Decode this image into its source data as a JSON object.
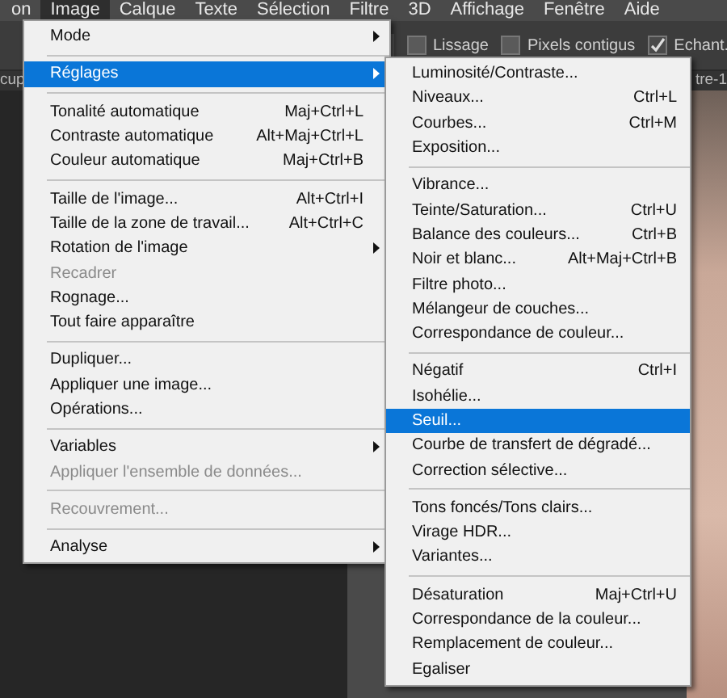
{
  "menubar": [
    {
      "label": "on",
      "selected": false
    },
    {
      "label": "Image",
      "selected": true
    },
    {
      "label": "Calque",
      "selected": false
    },
    {
      "label": "Texte",
      "selected": false
    },
    {
      "label": "Sélection",
      "selected": false
    },
    {
      "label": "Filtre",
      "selected": false
    },
    {
      "label": "3D",
      "selected": false
    },
    {
      "label": "Affichage",
      "selected": false
    },
    {
      "label": "Fenêtre",
      "selected": false
    },
    {
      "label": "Aide",
      "selected": false
    }
  ],
  "options_bar": {
    "checkboxes": [
      {
        "label": "Lissage",
        "checked": false
      },
      {
        "label": "Pixels contigus",
        "checked": false
      },
      {
        "label": "Echant.",
        "checked": true
      }
    ]
  },
  "document_tabs": [
    {
      "label": "cup"
    },
    {
      "label": "tre-1"
    }
  ],
  "image_menu": {
    "groups": [
      [
        {
          "label": "Mode",
          "has_submenu": true,
          "disabled": false,
          "selected": false
        }
      ],
      [
        {
          "label": "Réglages",
          "has_submenu": true,
          "disabled": false,
          "selected": true
        }
      ],
      [
        {
          "label": "Tonalité automatique",
          "shortcut": "Maj+Ctrl+L",
          "has_submenu": false,
          "disabled": false,
          "selected": false
        },
        {
          "label": "Contraste automatique",
          "shortcut": "Alt+Maj+Ctrl+L",
          "has_submenu": false,
          "disabled": false,
          "selected": false
        },
        {
          "label": "Couleur automatique",
          "shortcut": "Maj+Ctrl+B",
          "has_submenu": false,
          "disabled": false,
          "selected": false
        }
      ],
      [
        {
          "label": "Taille de l'image...",
          "shortcut": "Alt+Ctrl+I",
          "has_submenu": false,
          "disabled": false,
          "selected": false
        },
        {
          "label": "Taille de la zone de travail...",
          "shortcut": "Alt+Ctrl+C",
          "has_submenu": false,
          "disabled": false,
          "selected": false
        },
        {
          "label": "Rotation de l'image",
          "has_submenu": true,
          "disabled": false,
          "selected": false
        },
        {
          "label": "Recadrer",
          "has_submenu": false,
          "disabled": true,
          "selected": false
        },
        {
          "label": "Rognage...",
          "has_submenu": false,
          "disabled": false,
          "selected": false
        },
        {
          "label": "Tout faire apparaître",
          "has_submenu": false,
          "disabled": false,
          "selected": false
        }
      ],
      [
        {
          "label": "Dupliquer...",
          "has_submenu": false,
          "disabled": false,
          "selected": false
        },
        {
          "label": "Appliquer une image...",
          "has_submenu": false,
          "disabled": false,
          "selected": false
        },
        {
          "label": "Opérations...",
          "has_submenu": false,
          "disabled": false,
          "selected": false
        }
      ],
      [
        {
          "label": "Variables",
          "has_submenu": true,
          "disabled": false,
          "selected": false
        },
        {
          "label": "Appliquer l'ensemble de données...",
          "has_submenu": false,
          "disabled": true,
          "selected": false
        }
      ],
      [
        {
          "label": "Recouvrement...",
          "has_submenu": false,
          "disabled": true,
          "selected": false
        }
      ],
      [
        {
          "label": "Analyse",
          "has_submenu": true,
          "disabled": false,
          "selected": false
        }
      ]
    ]
  },
  "adjustments_submenu": {
    "groups": [
      [
        {
          "label": "Luminosité/Contraste...",
          "selected": false
        },
        {
          "label": "Niveaux...",
          "shortcut": "Ctrl+L",
          "selected": false
        },
        {
          "label": "Courbes...",
          "shortcut": "Ctrl+M",
          "selected": false
        },
        {
          "label": "Exposition...",
          "selected": false
        }
      ],
      [
        {
          "label": "Vibrance...",
          "selected": false
        },
        {
          "label": "Teinte/Saturation...",
          "shortcut": "Ctrl+U",
          "selected": false
        },
        {
          "label": "Balance des couleurs...",
          "shortcut": "Ctrl+B",
          "selected": false
        },
        {
          "label": "Noir et blanc...",
          "shortcut": "Alt+Maj+Ctrl+B",
          "selected": false
        },
        {
          "label": "Filtre photo...",
          "selected": false
        },
        {
          "label": "Mélangeur de couches...",
          "selected": false
        },
        {
          "label": "Correspondance de couleur...",
          "selected": false
        }
      ],
      [
        {
          "label": "Négatif",
          "shortcut": "Ctrl+I",
          "selected": false
        },
        {
          "label": "Isohélie...",
          "selected": false
        },
        {
          "label": "Seuil...",
          "selected": true
        },
        {
          "label": "Courbe de transfert de dégradé...",
          "selected": false
        },
        {
          "label": "Correction sélective...",
          "selected": false
        }
      ],
      [
        {
          "label": "Tons foncés/Tons clairs...",
          "selected": false
        },
        {
          "label": "Virage HDR...",
          "selected": false
        },
        {
          "label": "Variantes...",
          "selected": false
        }
      ],
      [
        {
          "label": "Désaturation",
          "shortcut": "Maj+Ctrl+U",
          "selected": false
        },
        {
          "label": "Correspondance de la couleur...",
          "selected": false
        },
        {
          "label": "Remplacement de couleur...",
          "selected": false
        },
        {
          "label": "Egaliser",
          "selected": false
        }
      ]
    ]
  }
}
